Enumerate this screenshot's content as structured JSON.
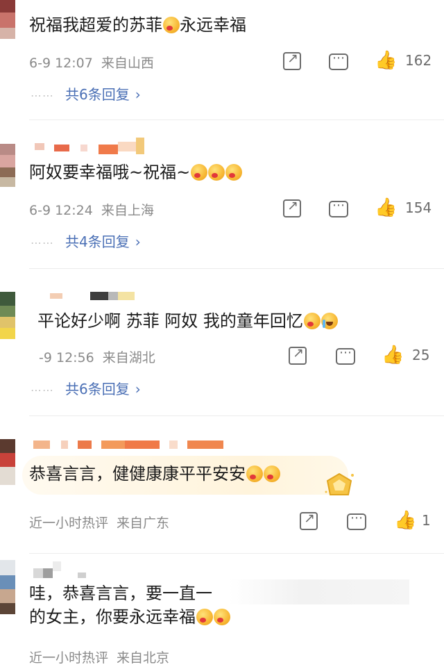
{
  "comments": [
    {
      "text": "祝福我超爱的苏菲",
      "text_after_emoji": "永远幸福",
      "date": "6-9 12:07",
      "location": "来自山西",
      "likes": "162",
      "replies": "共6条回复"
    },
    {
      "text": "阿奴要幸福哦~祝福~",
      "date": "6-9 12:24",
      "location": "来自上海",
      "likes": "154",
      "replies": "共4条回复"
    },
    {
      "text": "平论好少啊 苏菲 阿奴 我的童年回忆",
      "date": "-9 12:56",
      "location": "来自湖北",
      "likes": "25",
      "replies": "共6条回复"
    },
    {
      "text": "恭喜言言，健健康康平平安安",
      "date": "近一小时热评",
      "location": "来自广东",
      "likes": "1"
    },
    {
      "text_line1": "哇，恭喜言言，要一直一",
      "text_line2": "的女主，你要永远幸福",
      "date": "近一小时热评",
      "location": "来自北京"
    }
  ],
  "ui": {
    "dots": "⋯⋯",
    "chevron": "›",
    "like_icon": "👍"
  },
  "colors": {
    "link": "#4a6fb5",
    "meta": "#8a8a8a",
    "divider": "#ececec"
  }
}
